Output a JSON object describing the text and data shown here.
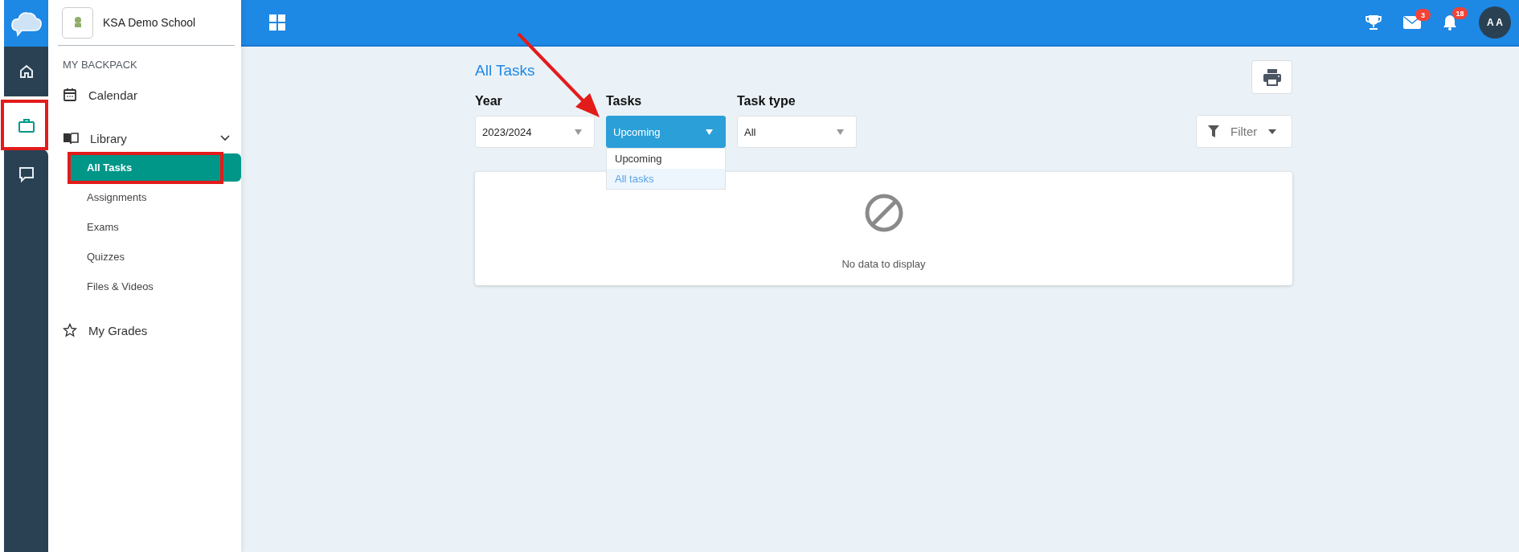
{
  "rail": [
    {
      "selected": false
    },
    {
      "selected": true
    },
    {
      "selected": false
    }
  ],
  "school": {
    "name": "KSA Demo School"
  },
  "sidebar": {
    "section": "MY BACKPACK",
    "items": [
      {
        "label": "Calendar"
      },
      {
        "label": "Library",
        "expanded": true,
        "children": [
          {
            "label": "All Tasks",
            "selected": true
          },
          {
            "label": "Assignments",
            "selected": false
          },
          {
            "label": "Exams",
            "selected": false
          },
          {
            "label": "Quizzes",
            "selected": false
          },
          {
            "label": "Files & Videos",
            "selected": false
          }
        ]
      },
      {
        "label": "My Grades"
      }
    ]
  },
  "topbar": {
    "mail_count": "3",
    "bell_count": "18",
    "avatar": "A A"
  },
  "page": {
    "title": "All Tasks",
    "filters": [
      {
        "label": "Year",
        "value": "2023/2024",
        "open": false
      },
      {
        "label": "Tasks",
        "value": "Upcoming",
        "open": true,
        "options": [
          {
            "label": "Upcoming",
            "highlighted": false
          },
          {
            "label": "All tasks",
            "highlighted": true
          }
        ]
      },
      {
        "label": "Task type",
        "value": "All",
        "open": false
      }
    ],
    "filter_button": "Filter",
    "empty_message": "No data to display"
  }
}
